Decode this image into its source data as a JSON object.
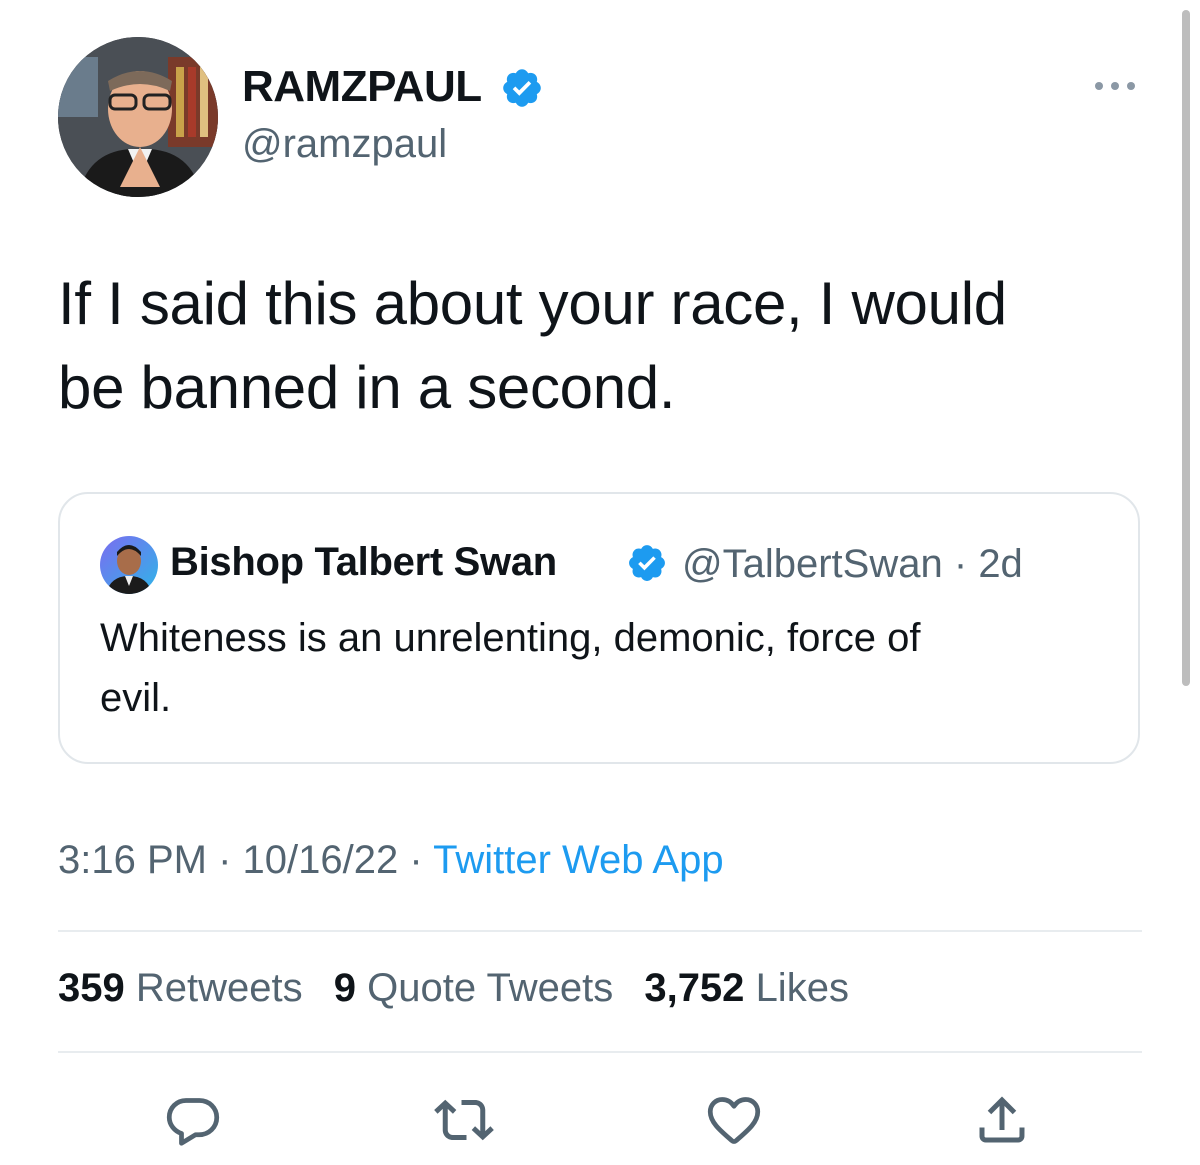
{
  "tweet": {
    "display_name": "RAMZPAUL",
    "handle": "@ramzpaul",
    "text_line1": "If I said this about your race, I would",
    "text_line2": "be banned in a second.",
    "time": "3:16 PM",
    "date": "10/16/22",
    "source": "Twitter Web App",
    "separator": "·"
  },
  "quoted": {
    "display_name": "Bishop Talbert Swan",
    "handle": "@TalbertSwan",
    "age": "2d",
    "text_line1": "Whiteness is an unrelenting, demonic, force of",
    "text_line2": "evil."
  },
  "stats": {
    "retweets_count": "359",
    "retweets_label": "Retweets",
    "quotes_count": "9",
    "quotes_label": "Quote Tweets",
    "likes_count": "3,752",
    "likes_label": "Likes"
  },
  "icons": {
    "verified": "verified-badge-icon",
    "more": "more-options-icon",
    "reply": "reply-icon",
    "retweet": "retweet-icon",
    "like": "heart-icon",
    "share": "share-icon"
  },
  "colors": {
    "verified": "#1d9bf0",
    "link": "#1d9bf0",
    "secondary_text": "#536471",
    "icon": "#536471",
    "divider": "#e8ecef"
  }
}
